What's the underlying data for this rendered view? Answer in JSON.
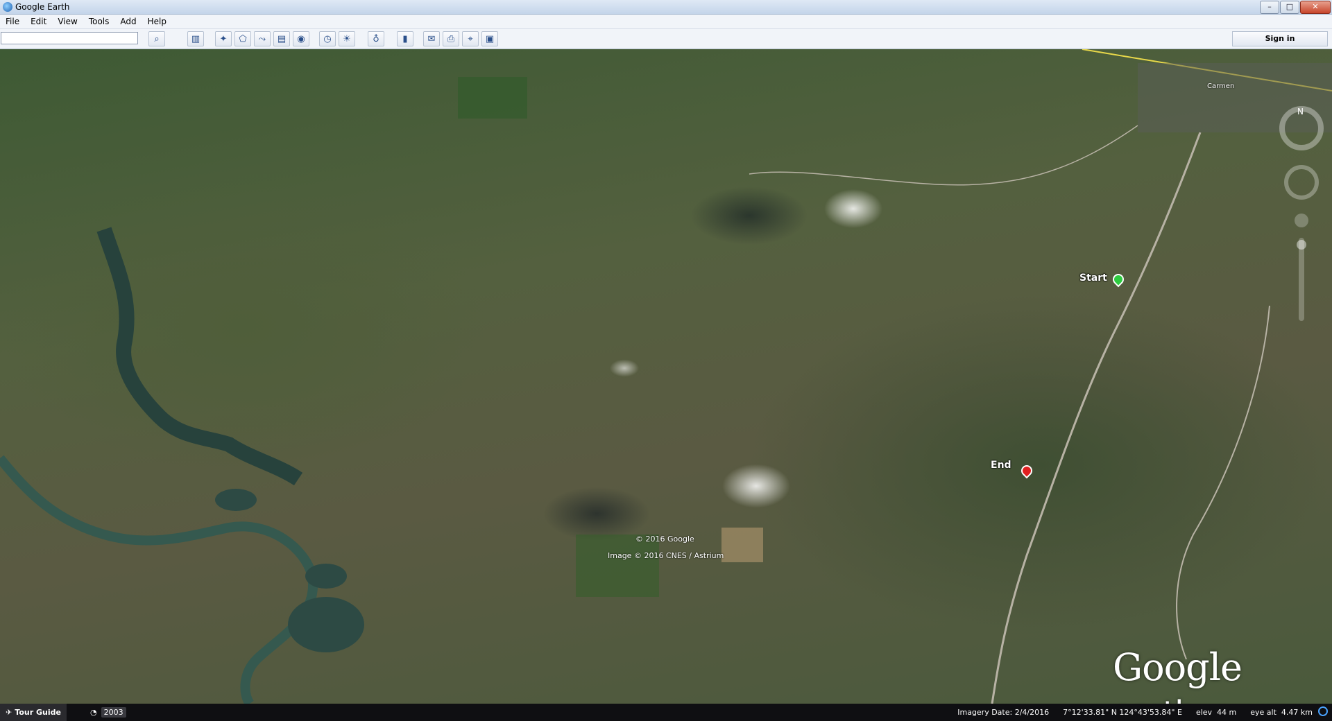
{
  "window": {
    "title": "Google Earth",
    "minimize": "–",
    "maximize": "□",
    "close": "✕"
  },
  "menu": [
    "File",
    "Edit",
    "View",
    "Tools",
    "Add",
    "Help"
  ],
  "toolbar": {
    "search_placeholder": "",
    "search_icon": "magnifier-icon",
    "buttons": [
      "sidebar-icon",
      "placemark-icon",
      "polygon-icon",
      "path-icon",
      "image-overlay-icon",
      "tour-icon",
      "historical-imagery-icon",
      "sunlight-icon",
      "planets-icon",
      "ruler-icon",
      "email-icon",
      "print-icon",
      "google-maps-icon",
      "save-image-icon"
    ],
    "sign_in": "Sign in"
  },
  "map": {
    "city": "Carmen",
    "placemarks": [
      {
        "label": "Start",
        "color": "#2ecc40"
      },
      {
        "label": "End",
        "color": "#e02020"
      }
    ],
    "copyright_1": "© 2016 Google",
    "copyright_2": "Image © 2016 CNES / Astrium",
    "logo_main": "Google",
    "logo_sub": "earth"
  },
  "status": {
    "tour_guide": "Tour Guide",
    "year": "2003",
    "imagery_date": "Imagery Date: 2/4/2016",
    "coords": "7°12'33.81\" N  124°43'53.84\" E",
    "elev_label": "elev",
    "elev_value": "44 m",
    "eye_alt_label": "eye alt",
    "eye_alt_value": "4.47 km"
  },
  "colors": {
    "water": "#2c4a46",
    "road": "#b7b2a4"
  }
}
